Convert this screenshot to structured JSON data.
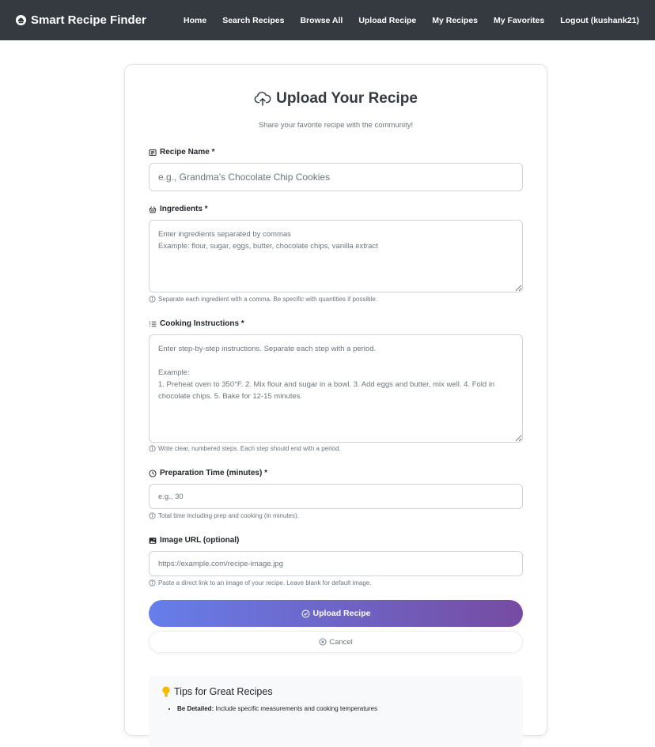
{
  "navbar": {
    "brand": "Smart Recipe Finder",
    "brand_icon": "chef-hat-icon",
    "links": [
      "Home",
      "Search Recipes",
      "Browse All",
      "Upload Recipe",
      "My Recipes",
      "My Favorites",
      "Logout (kushank21)"
    ]
  },
  "page": {
    "title": "Upload Your Recipe",
    "title_icon": "cloud-upload-icon",
    "subtitle": "Share your favorite recipe with the community!"
  },
  "form": {
    "name": {
      "label": "Recipe Name *",
      "icon": "card-text-icon",
      "placeholder": "e.g., Grandma's Chocolate Chip Cookies"
    },
    "ingredients": {
      "label": "Ingredients *",
      "icon": "basket-icon",
      "placeholder": "Enter ingredients separated by commas\nExample: flour, sugar, eggs, butter, chocolate chips, vanilla extract",
      "help": "Separate each ingredient with a comma. Be specific with quantities if possible."
    },
    "instructions": {
      "label": "Cooking Instructions *",
      "icon": "list-ordered-icon",
      "placeholder": "Enter step-by-step instructions. Separate each step with a period.\n\nExample:\n1. Preheat oven to 350°F. 2. Mix flour and sugar in a bowl. 3. Add eggs and butter, mix well. 4. Fold in chocolate chips. 5. Bake for 12-15 minutes.",
      "help": "Write clear, numbered steps. Each step should end with a period."
    },
    "prep_time": {
      "label": "Preparation Time (minutes) *",
      "icon": "clock-icon",
      "placeholder": "e.g., 30",
      "help": "Total time including prep and cooking (in minutes)."
    },
    "image_url": {
      "label": "Image URL (optional)",
      "icon": "image-icon",
      "placeholder": "https://example.com/recipe-image.jpg",
      "help": "Paste a direct link to an image of your recipe. Leave blank for default image."
    },
    "submit_label": "Upload Recipe",
    "submit_icon": "check-circle-icon",
    "cancel_label": "Cancel",
    "cancel_icon": "x-circle-icon"
  },
  "tips": {
    "title": "Tips for Great Recipes",
    "icon": "lightbulb-icon",
    "items": [
      {
        "strong": "Be Detailed:",
        "text": " Include specific measurements and cooking temperatures"
      }
    ]
  },
  "colors": {
    "navbar_bg": "#343a40",
    "gradient_start": "#667eea",
    "gradient_end": "#764ba2",
    "tip_bulb": "#f5b800"
  }
}
